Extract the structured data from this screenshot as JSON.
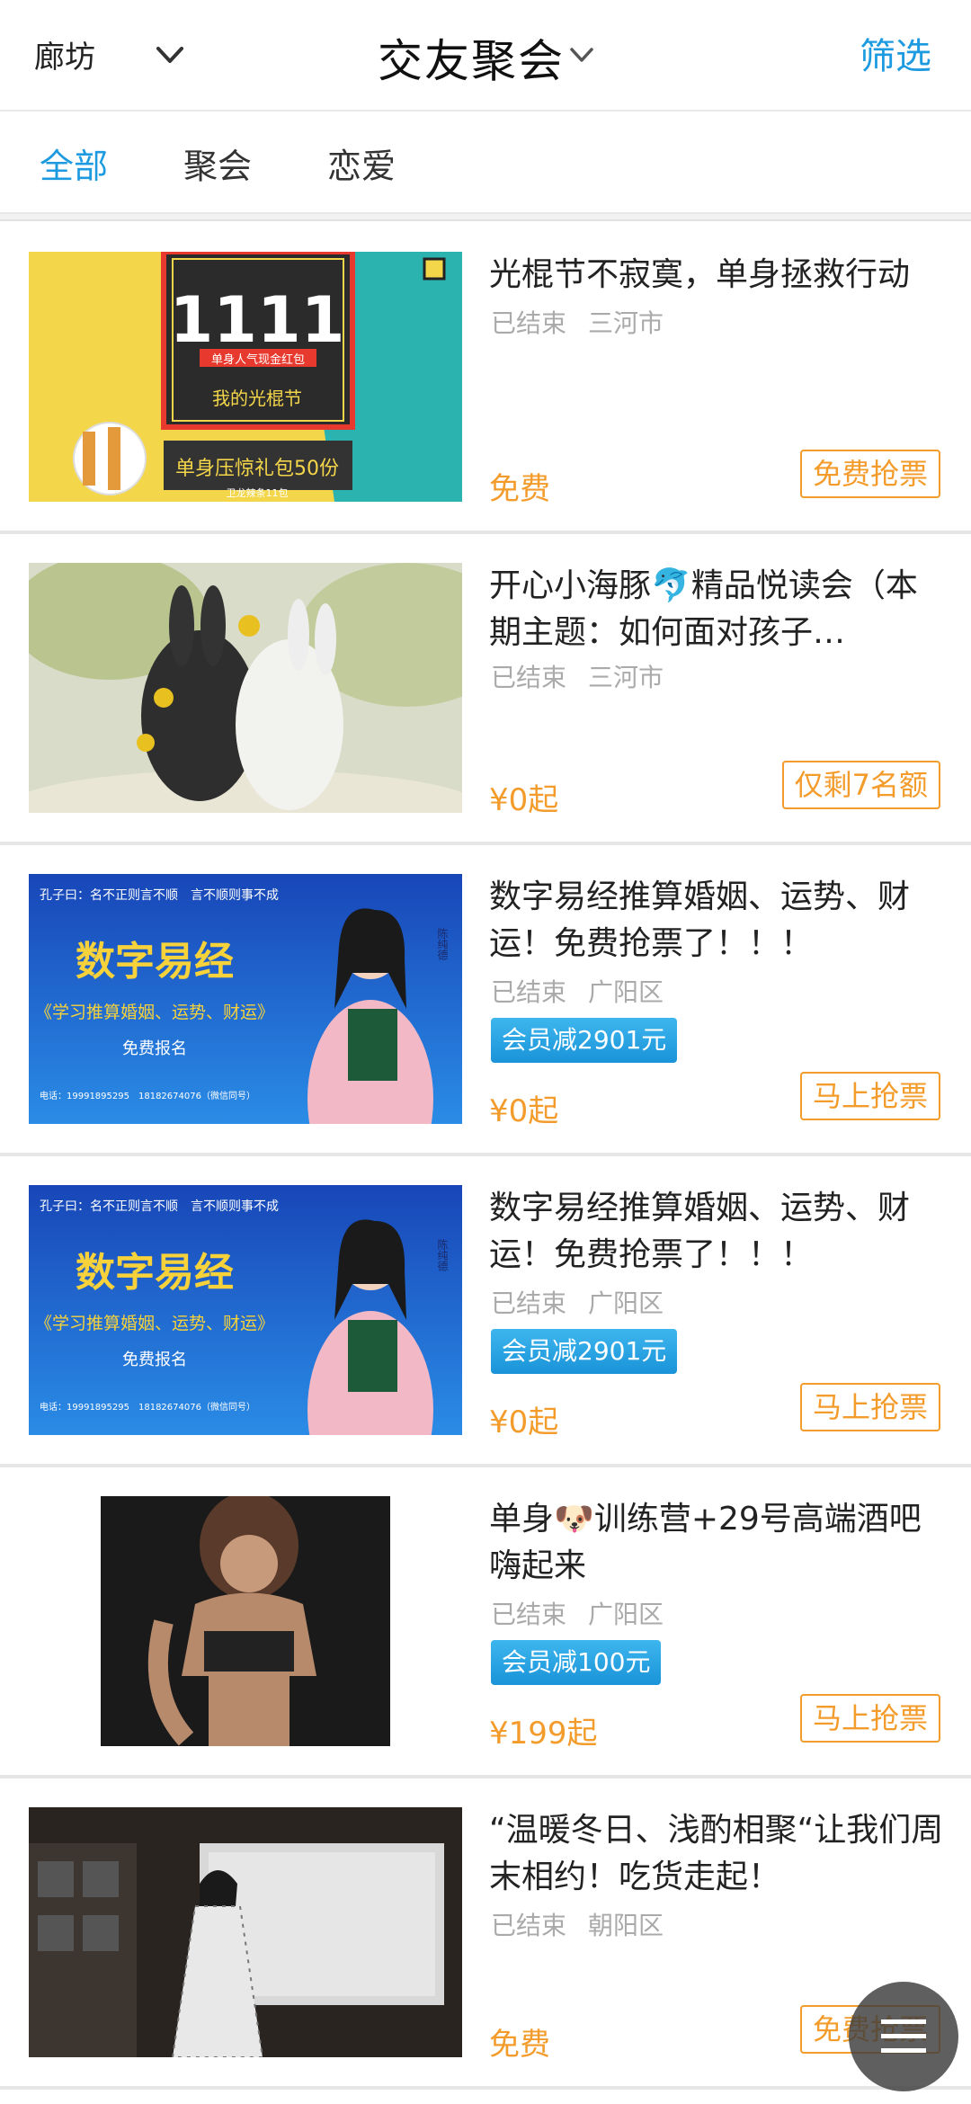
{
  "header": {
    "city": "廊坊",
    "title": "交友聚会",
    "filter_label": "筛选"
  },
  "tabs": [
    {
      "label": "全部",
      "active": true
    },
    {
      "label": "聚会",
      "active": false
    },
    {
      "label": "恋爱",
      "active": false
    }
  ],
  "events": [
    {
      "title": "光棍节不寂寞，单身拯救行动",
      "status": "已结束",
      "location": "三河市",
      "price": "免费",
      "action": "免费抢票",
      "image": {
        "amount": "1111",
        "banner": "单身人气现金红包",
        "subtitle": "我的光棍节",
        "bottom": "单身压惊礼包50份",
        "small": "卫龙辣条11包"
      }
    },
    {
      "title": "开心小海豚🐬精品悦读会（本期主题：如何面对孩子…",
      "status": "已结束",
      "location": "三河市",
      "price": "¥0起",
      "action": "仅剩7名额"
    },
    {
      "title": "数字易经推算婚姻、运势、财运！免费抢票了！！！",
      "status": "已结束",
      "location": "广阳区",
      "member_discount": "会员减2901元",
      "price": "¥0起",
      "action": "马上抢票",
      "image": {
        "top": "孔子曰：名不正则言不顺　言不顺则事不成",
        "headline": "数字易经",
        "sub": "《学习推算婚姻、运势、财运》",
        "free": "免费报名",
        "contact": "电话：19991895295　18182674076（微信同号）"
      }
    },
    {
      "title": "数字易经推算婚姻、运势、财运！免费抢票了！！！",
      "status": "已结束",
      "location": "广阳区",
      "member_discount": "会员减2901元",
      "price": "¥0起",
      "action": "马上抢票",
      "image": {
        "top": "孔子曰：名不正则言不顺　言不顺则事不成",
        "headline": "数字易经",
        "sub": "《学习推算婚姻、运势、财运》",
        "free": "免费报名",
        "contact": "电话：19991895295　18182674076（微信同号）"
      }
    },
    {
      "title": "单身🐶训练营+29号高端酒吧嗨起来",
      "status": "已结束",
      "location": "广阳区",
      "member_discount": "会员减100元",
      "price": "¥199起",
      "action": "马上抢票"
    },
    {
      "title": "“温暖冬日、浅酌相聚“让我们周末相约！吃货走起！",
      "status": "已结束",
      "location": "朝阳区",
      "price": "免费",
      "action": "免费抢票"
    }
  ],
  "colors": {
    "accent_blue": "#1e9be0",
    "price_orange": "#f39c2c",
    "meta_gray": "#aaaaaa"
  },
  "icons": {
    "city_dropdown": "chevron-down-icon",
    "title_dropdown": "chevron-down-icon",
    "fab": "menu-icon"
  }
}
